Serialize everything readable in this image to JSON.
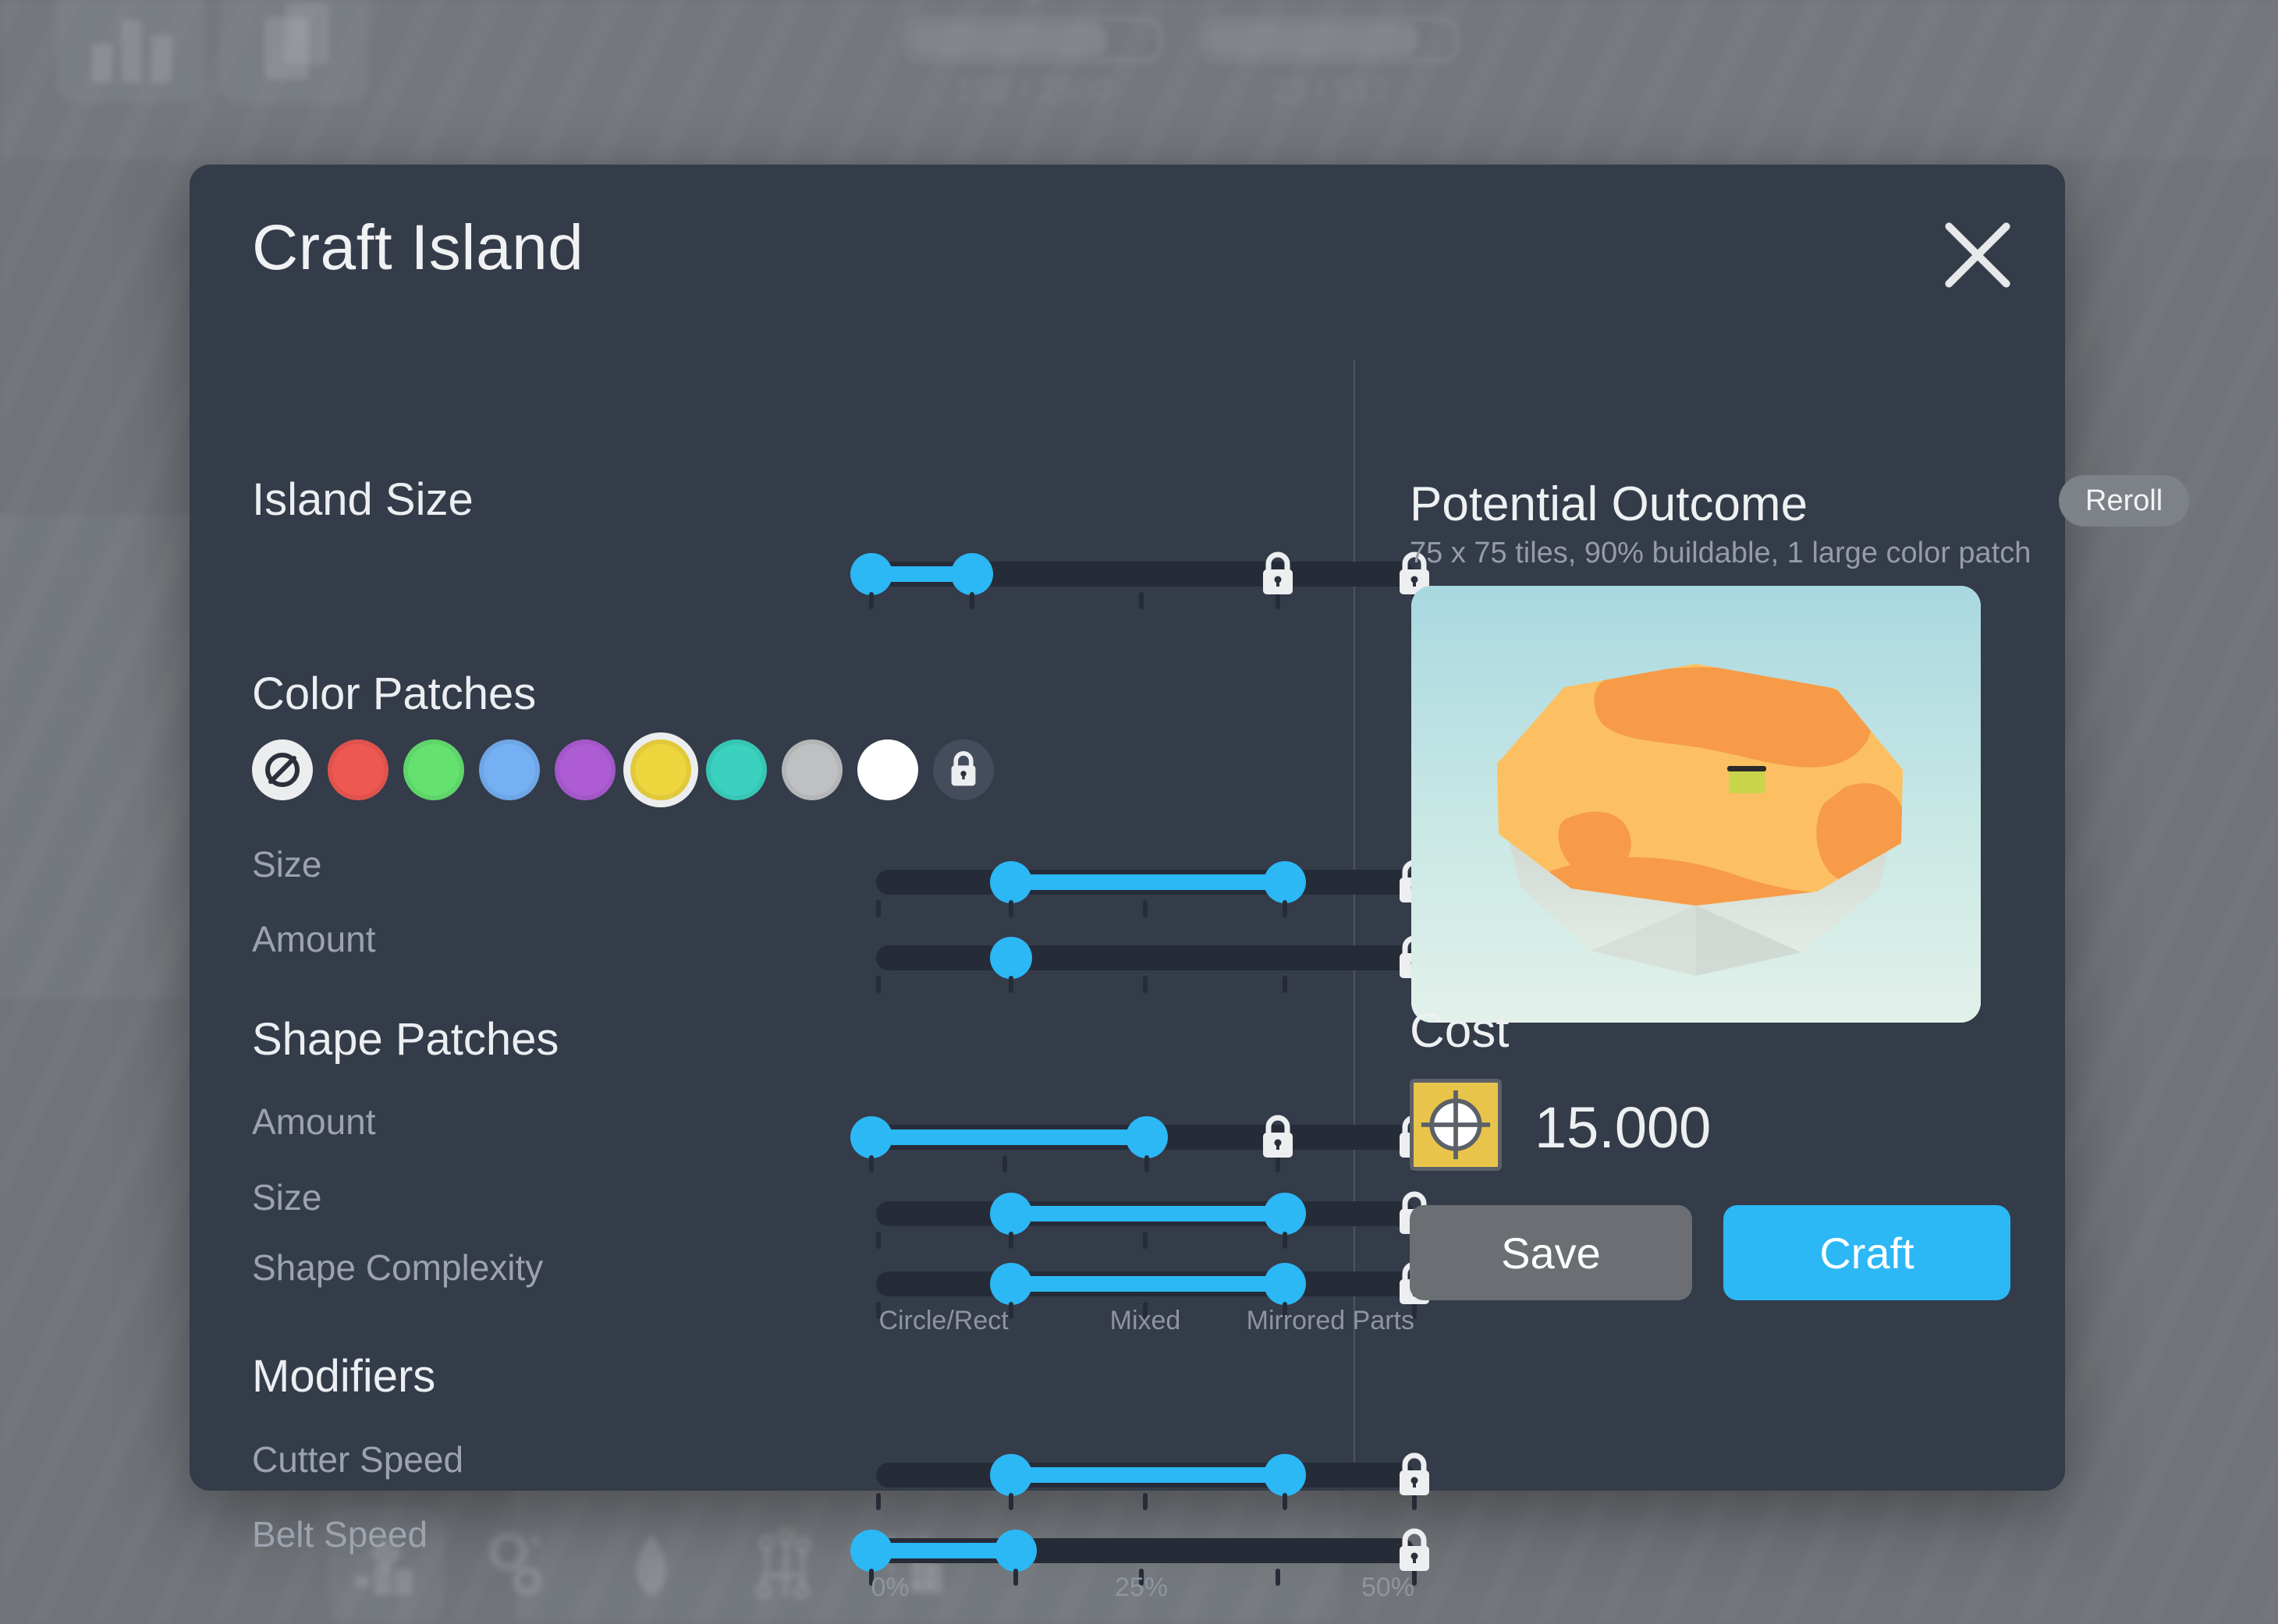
{
  "background": {
    "resources": [
      {
        "icon": "crosshair-coin-icon",
        "value": "158 / 2500",
        "progress": 0.72
      },
      {
        "icon": "blueprint-icon",
        "value": "23 / 512",
        "progress": 0.8
      }
    ],
    "dock_icons": [
      "buildings-icon",
      "gears-icon",
      "leaf-icon",
      "circuit-icon",
      "blueprint-copy-icon"
    ]
  },
  "modal": {
    "title": "Craft Island",
    "close_icon": "close-icon",
    "left": {
      "island_size": {
        "label": "Island Size",
        "slider": {
          "type": "range",
          "min_pct": 0.5,
          "max_pct": 19.0,
          "ticks_pct": [
            0.5,
            19.0,
            50.0,
            75.0,
            100.0
          ],
          "locks_pct": [
            75.0,
            100.0
          ],
          "lock_icon": "lock-icon"
        }
      },
      "color_patches": {
        "heading": "Color Patches",
        "swatches": [
          {
            "name": "none",
            "color": "#ecedee",
            "icon": "no-color-icon",
            "selected": false
          },
          {
            "name": "red",
            "color": "#e0534c",
            "selected": false
          },
          {
            "name": "green",
            "color": "#5fd46a",
            "selected": false
          },
          {
            "name": "blue",
            "color": "#6ea6e6",
            "selected": false
          },
          {
            "name": "purple",
            "color": "#a357c8",
            "selected": false
          },
          {
            "name": "yellow",
            "color": "#e0c93a",
            "selected": true
          },
          {
            "name": "teal",
            "color": "#37c5b4",
            "selected": false
          },
          {
            "name": "gray",
            "color": "#b3b5b6",
            "selected": false
          },
          {
            "name": "white",
            "color": "#ffffff",
            "selected": false
          },
          {
            "name": "locked",
            "color": "#454d5c",
            "icon": "lock-icon",
            "locked": true
          }
        ],
        "rows": [
          {
            "label": "Size",
            "slider": {
              "type": "range",
              "min_pct": 25.0,
              "max_pct": 76.0,
              "ticks_pct": [
                0.5,
                25.0,
                50.0,
                76.0,
                100.0
              ],
              "locks_pct": [
                100.0
              ],
              "lock_icon": "lock-icon"
            }
          },
          {
            "label": "Amount",
            "slider": {
              "type": "single",
              "value_pct": 25.0,
              "ticks_pct": [
                0.5,
                25.0,
                50.0,
                76.0,
                100.0
              ],
              "locks_pct": [
                100.0
              ],
              "lock_icon": "lock-icon"
            }
          }
        ]
      },
      "shape_patches": {
        "heading": "Shape Patches",
        "rows": [
          {
            "label": "Amount",
            "slider": {
              "type": "range",
              "min_pct": 0.5,
              "max_pct": 51.0,
              "ticks_pct": [
                0.5,
                25.0,
                51.0,
                75.0,
                100.0
              ],
              "locks_pct": [
                75.0,
                100.0
              ],
              "lock_icon": "lock-icon"
            }
          },
          {
            "label": "Size",
            "slider": {
              "type": "range",
              "min_pct": 25.0,
              "max_pct": 76.0,
              "ticks_pct": [
                0.5,
                25.0,
                50.0,
                76.0,
                100.0
              ],
              "locks_pct": [
                100.0
              ],
              "lock_icon": "lock-icon"
            }
          },
          {
            "label": "Shape Complexity",
            "slider": {
              "type": "range",
              "min_pct": 25.0,
              "max_pct": 76.0,
              "ticks_pct": [
                0.5,
                25.0,
                50.0,
                76.0,
                100.0
              ],
              "locks_pct": [
                100.0
              ],
              "lock_icon": "lock-icon"
            },
            "scale": [
              {
                "text": "Circle/Rect",
                "pos_pct": 0.5
              },
              {
                "text": "Mixed",
                "pos_pct": 50.0
              },
              {
                "text": "Mirrored Parts",
                "pos_pct": 100.0
              }
            ]
          }
        ]
      },
      "modifiers": {
        "heading": "Modifiers",
        "rows": [
          {
            "label": "Cutter Speed",
            "slider": {
              "type": "range",
              "min_pct": 25.0,
              "max_pct": 76.0,
              "ticks_pct": [
                0.5,
                25.0,
                50.0,
                76.0,
                100.0
              ],
              "locks_pct": [
                100.0
              ],
              "lock_icon": "lock-icon"
            }
          },
          {
            "label": "Belt Speed",
            "slider": {
              "type": "range",
              "min_pct": 0.5,
              "max_pct": 27.0,
              "ticks_pct": [
                0.5,
                27.0,
                50.0,
                75.0,
                100.0
              ],
              "locks_pct": [
                100.0
              ],
              "lock_icon": "lock-icon"
            },
            "scale": [
              {
                "text": "0%",
                "pos_pct": 0.5
              },
              {
                "text": "25%",
                "pos_pct": 50.0
              },
              {
                "text": "50%",
                "pos_pct": 100.0
              }
            ]
          }
        ]
      }
    },
    "right": {
      "outcome_title": "Potential Outcome",
      "reroll_label": "Reroll",
      "outcome_summary": "75 x 75 tiles, 90% buildable, 1 large color patch",
      "preview_alt": "island-preview",
      "cost_title": "Cost",
      "cost_icon": "crosshair-coin-icon",
      "cost_value": "15.000",
      "save_label": "Save",
      "craft_label": "Craft"
    }
  },
  "colors": {
    "accent": "#2cb7f5",
    "modal_bg": "#343b49",
    "track": "#262c37",
    "coin": "#e8c54a",
    "save_btn": "#6b6f74"
  }
}
